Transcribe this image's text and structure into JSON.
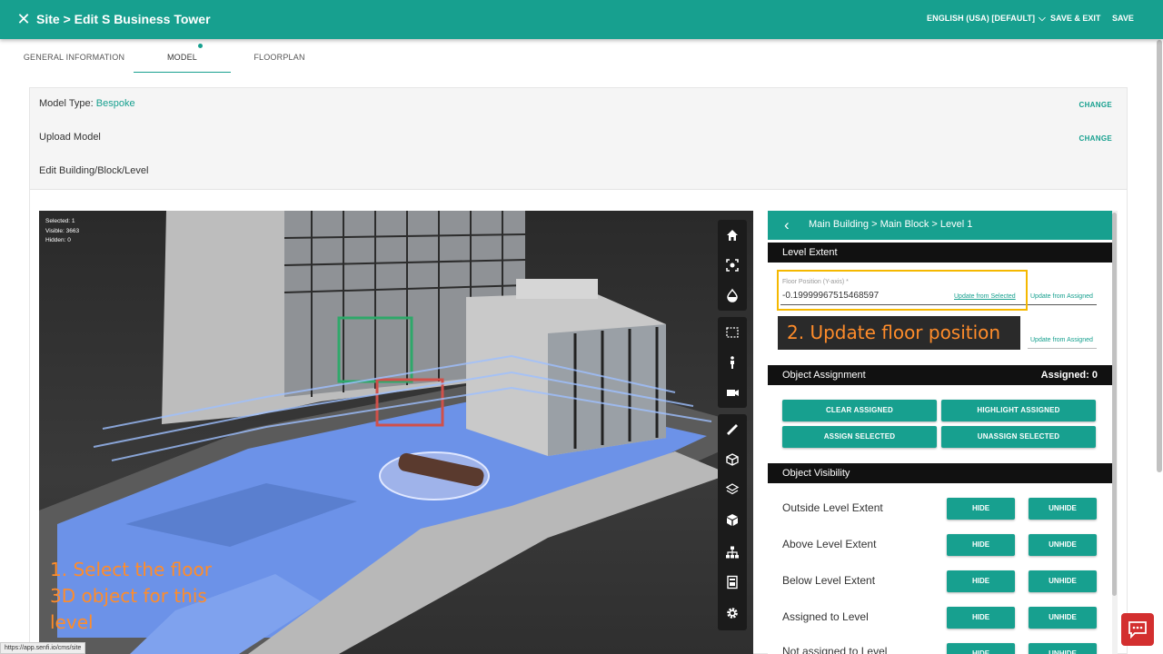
{
  "header": {
    "title": "Site > Edit S Business Tower",
    "language": "ENGLISH (USA) [DEFAULT]",
    "save_exit": "SAVE & EXIT",
    "save": "SAVE"
  },
  "tabs": [
    {
      "label": "GENERAL INFORMATION"
    },
    {
      "label": "MODEL"
    },
    {
      "label": "FLOORPLAN"
    }
  ],
  "rows": {
    "model_type_label": "Model Type:",
    "model_type_value": "Bespoke",
    "upload_model": "Upload Model",
    "edit_building": "Edit Building/Block/Level",
    "change": "CHANGE"
  },
  "viewer": {
    "stats": {
      "selected": "Selected: 1",
      "visible": "Visible: 3663",
      "hidden": "Hidden: 0"
    },
    "annotation_lines": [
      "1. Select the floor",
      "3D object for this",
      "level"
    ]
  },
  "side": {
    "breadcrumb": "Main Building > Main Block > Level 1",
    "level_extent": "Level Extent",
    "floor_label": "Floor Position (Y-axis) *",
    "floor_value": "-0.19999967515468597",
    "update_from_selected": "Update from Selected",
    "update_from_assigned": "Update from Assigned",
    "callout": "2. Update floor position",
    "object_assignment": "Object Assignment",
    "assigned_count": "Assigned: 0",
    "buttons": {
      "clear_assigned": "CLEAR ASSIGNED",
      "highlight_assigned": "HIGHLIGHT ASSIGNED",
      "assign_selected": "ASSIGN SELECTED",
      "unassign_selected": "UNASSIGN SELECTED"
    },
    "object_visibility": "Object Visibility",
    "visibility_rows": [
      {
        "label": "Outside Level Extent",
        "hide": "HIDE",
        "unhide": "UNHIDE"
      },
      {
        "label": "Above Level Extent",
        "hide": "HIDE",
        "unhide": "UNHIDE"
      },
      {
        "label": "Below Level Extent",
        "hide": "HIDE",
        "unhide": "UNHIDE"
      },
      {
        "label": "Assigned to Level",
        "hide": "HIDE",
        "unhide": "UNHIDE"
      },
      {
        "label": "Not assigned to Level",
        "hide": "HIDE",
        "unhide": "UNHIDE"
      }
    ]
  },
  "status_url": "https://app.senfi.io/cms/site",
  "colors": {
    "brand": "#17a08f",
    "annotation": "#ff8c2a",
    "highlight": "#f5b800",
    "chat": "#d32f2f"
  },
  "icons": [
    "close-icon",
    "chevron-down-icon",
    "home-icon",
    "fit-view-icon",
    "render-mode-icon",
    "select-box-icon",
    "person-icon",
    "camera-icon",
    "ruler-icon",
    "section-box-icon",
    "layers-icon",
    "model-icon",
    "structure-icon",
    "properties-icon",
    "gear-icon",
    "back-arrow-icon",
    "chat-icon"
  ]
}
